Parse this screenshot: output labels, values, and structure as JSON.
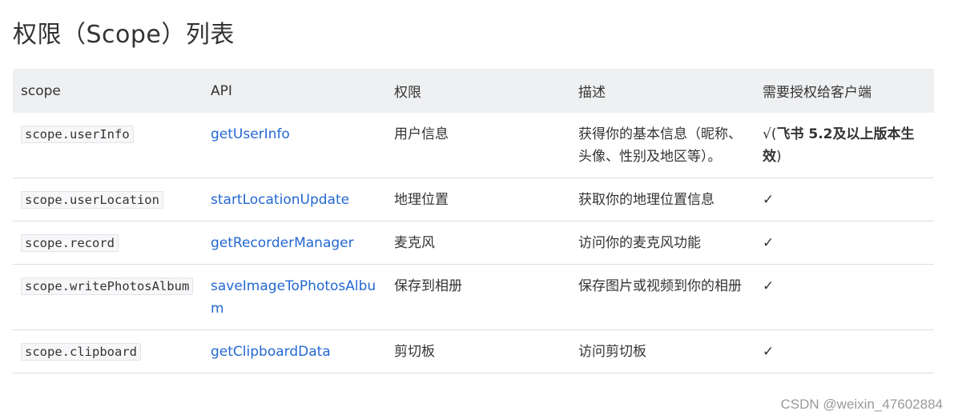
{
  "title": "权限（Scope）列表",
  "table": {
    "headers": [
      "scope",
      "API",
      "权限",
      "描述",
      "需要授权给客户端"
    ],
    "rows": [
      {
        "scope": "scope.userInfo",
        "api": "getUserInfo",
        "permission": "用户信息",
        "description": "获得你的基本信息（昵称、头像、性别及地区等）。",
        "client_prefix": "√(",
        "client_bold": "飞书 5.2及以上版本生效",
        "client_suffix": ")"
      },
      {
        "scope": "scope.userLocation",
        "api": "startLocationUpdate",
        "permission": "地理位置",
        "description": "获取你的地理位置信息",
        "client": "✓"
      },
      {
        "scope": "scope.record",
        "api": "getRecorderManager",
        "permission": "麦克风",
        "description": "访问你的麦克风功能",
        "client": "✓"
      },
      {
        "scope": "scope.writePhotosAlbum",
        "api": "saveImageToPhotosAlbum",
        "permission": "保存到相册",
        "description": "保存图片或视频到你的相册",
        "client": "✓"
      },
      {
        "scope": "scope.clipboard",
        "api": "getClipboardData",
        "permission": "剪切板",
        "description": "访问剪切板",
        "client": "✓"
      }
    ]
  },
  "watermark": "CSDN @weixin_47602884",
  "colors": {
    "link": "#2468d2",
    "header_bg": "#eff0f2",
    "border": "#dcdee2",
    "text": "#333333"
  }
}
